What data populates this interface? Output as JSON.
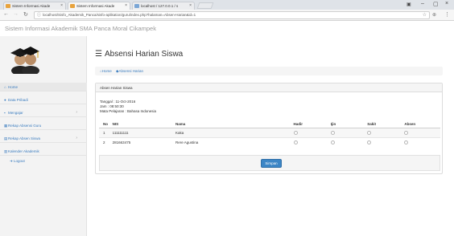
{
  "browser": {
    "tabs": [
      {
        "label": "Sistem Informasi Akade"
      },
      {
        "label": "Sistem Informasi Akade"
      },
      {
        "label": "localhost / 127.0.0.1 / s"
      }
    ],
    "url": "localhost/Sisfo_Akademik_Panca/sisfo-aplikation/guru/index.php?halaman=Absen-Harian&id=1"
  },
  "site": {
    "title": "Sistem Informasi Akademik SMA Panca Moral Cikampek"
  },
  "sidebar": {
    "items": [
      {
        "icon": "home-icon",
        "glyph": "⌂",
        "label": "Home"
      },
      {
        "icon": "user-icon",
        "glyph": "●",
        "label": "Data Pribadi"
      },
      {
        "icon": "briefcase-icon",
        "glyph": "▪",
        "label": "Mengajar"
      },
      {
        "icon": "table-icon",
        "glyph": "▦",
        "label": "Rekap Absensi Guru"
      },
      {
        "icon": "chart-icon",
        "glyph": "▤",
        "label": "Rekap Absen Siswa"
      },
      {
        "icon": "calendar-icon",
        "glyph": "▥",
        "label": "Kalender Akademik"
      },
      {
        "icon": "logout-icon",
        "glyph": "➜",
        "label": "Logout"
      }
    ]
  },
  "main": {
    "title": "Absensi Harian Siswa",
    "breadcrumb": {
      "home": "Home",
      "current": "Absensi Harian"
    },
    "panel": {
      "heading": "Absen Harian Siswa",
      "tanggal": "Tanggal : 11-Oct-2016",
      "jam": "Jam : 08:50:30",
      "mapel": "Mata Pelajaran : Bahasa Indonesia"
    },
    "table": {
      "headers": [
        "No",
        "NIS",
        "Nama",
        "Hadir",
        "Ijin",
        "Sakit",
        "Absen"
      ],
      "rows": [
        {
          "no": "1",
          "nis": "111111111",
          "nama": "Kaka"
        },
        {
          "no": "2",
          "nis": "281663475",
          "nama": "Rere Agustina"
        }
      ]
    },
    "save_label": "Simpan"
  },
  "colors": {
    "accent": "#3c86c6",
    "link": "#3a7cbf"
  }
}
